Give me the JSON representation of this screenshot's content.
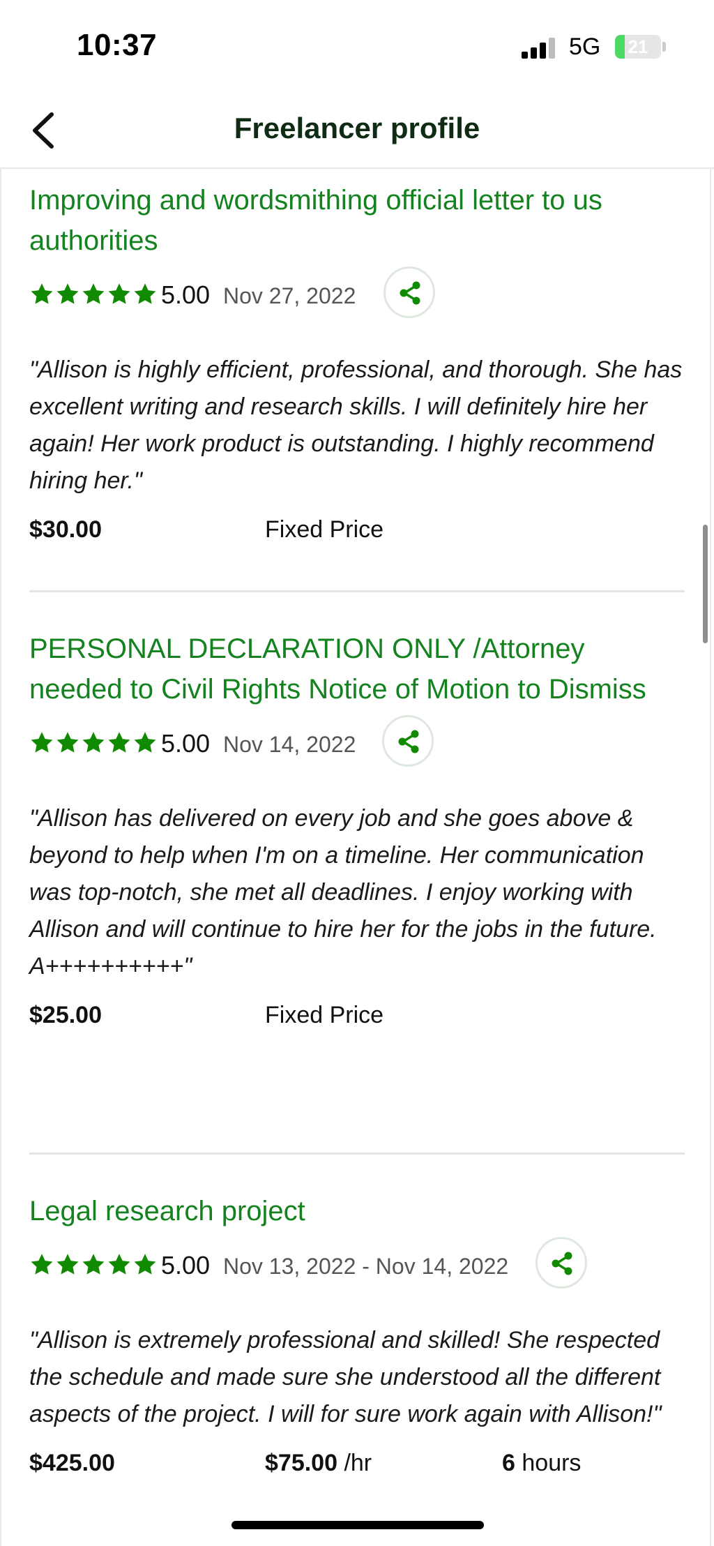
{
  "status_bar": {
    "time": "10:37",
    "network": "5G",
    "battery": "21",
    "battery_fraction": 0.21
  },
  "nav": {
    "title": "Freelancer profile"
  },
  "colors": {
    "accent": "#14821e",
    "star": "#108a00"
  },
  "reviews": [
    {
      "title": "Improving and wordsmithing official letter to us authorities",
      "score": "5.00",
      "date": "Nov 27, 2022",
      "quote": "\"Allison is highly efficient, professional, and thorough. She has excellent writing and research skills. I will definitely hire her again! Her work product is outstanding. I highly recommend hiring her.\"",
      "amount": "$30.00",
      "type": "Fixed Price"
    },
    {
      "title": "PERSONAL DECLARATION ONLY /Attorney needed to Civil Rights Notice of Motion to Dismiss",
      "score": "5.00",
      "date": "Nov 14, 2022",
      "quote": "\"Allison has delivered on every job and she goes above & beyond to help when I'm on a timeline. Her communication was top-notch, she met all deadlines. I enjoy working with Allison and will continue to hire her for the jobs in the future.\nA++++++++++\"",
      "amount": "$25.00",
      "type": "Fixed Price"
    },
    {
      "title": "Legal research project",
      "score": "5.00",
      "date": "Nov 13, 2022 - Nov 14, 2022",
      "quote": "\"Allison is extremely professional and skilled! She respected the schedule and made sure she understood all the different aspects of the project. I will for sure work again with Allison!\"",
      "amount": "$425.00",
      "rate": "$75.00",
      "rate_unit": "/hr",
      "hours": "6",
      "hours_unit": "hours"
    }
  ]
}
